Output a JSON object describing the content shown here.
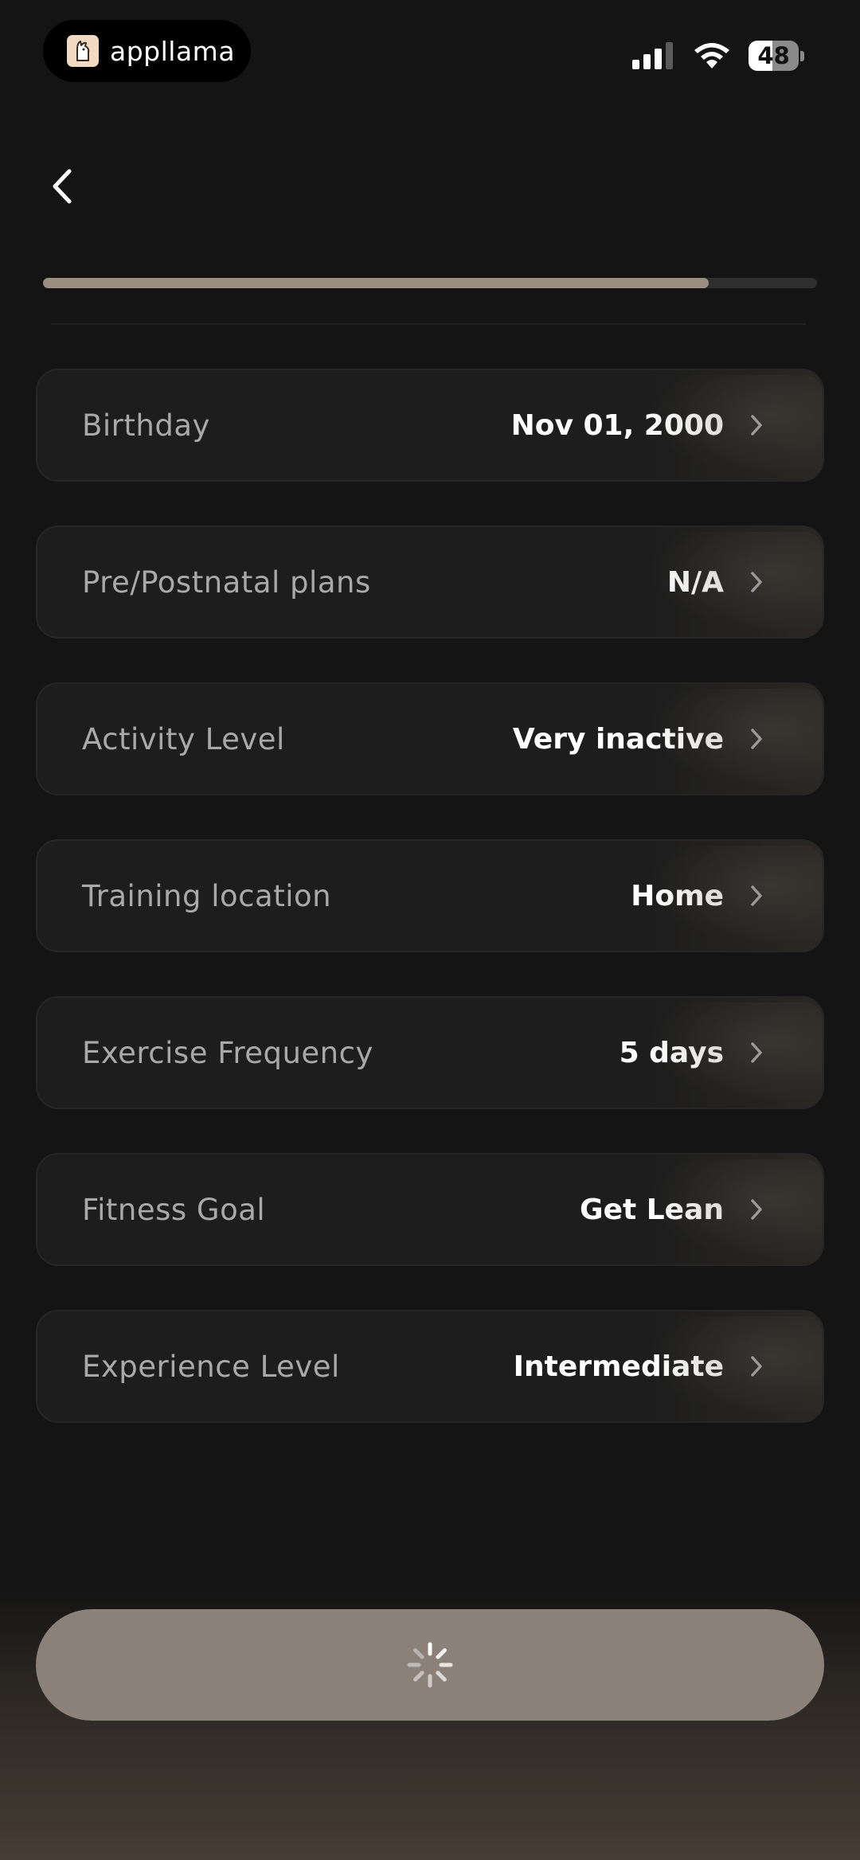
{
  "status_bar": {
    "brand": "appllama",
    "battery": "48"
  },
  "progress": {
    "fraction": 0.86
  },
  "rows": [
    {
      "label": "Birthday",
      "value": "Nov 01, 2000"
    },
    {
      "label": "Pre/Postnatal plans",
      "value": "N/A"
    },
    {
      "label": "Activity Level",
      "value": "Very inactive"
    },
    {
      "label": "Training location",
      "value": "Home"
    },
    {
      "label": "Exercise Frequency",
      "value": "5 days"
    },
    {
      "label": "Fitness Goal",
      "value": "Get Lean"
    },
    {
      "label": "Experience Level",
      "value": "Intermediate"
    }
  ],
  "icons": {
    "back": "chevron-left-icon",
    "row_chevron": "chevron-right-icon",
    "loading": "spinner-icon"
  },
  "colors": {
    "background": "#141414",
    "accent": "#9b8f83",
    "button": "#8b8178"
  }
}
